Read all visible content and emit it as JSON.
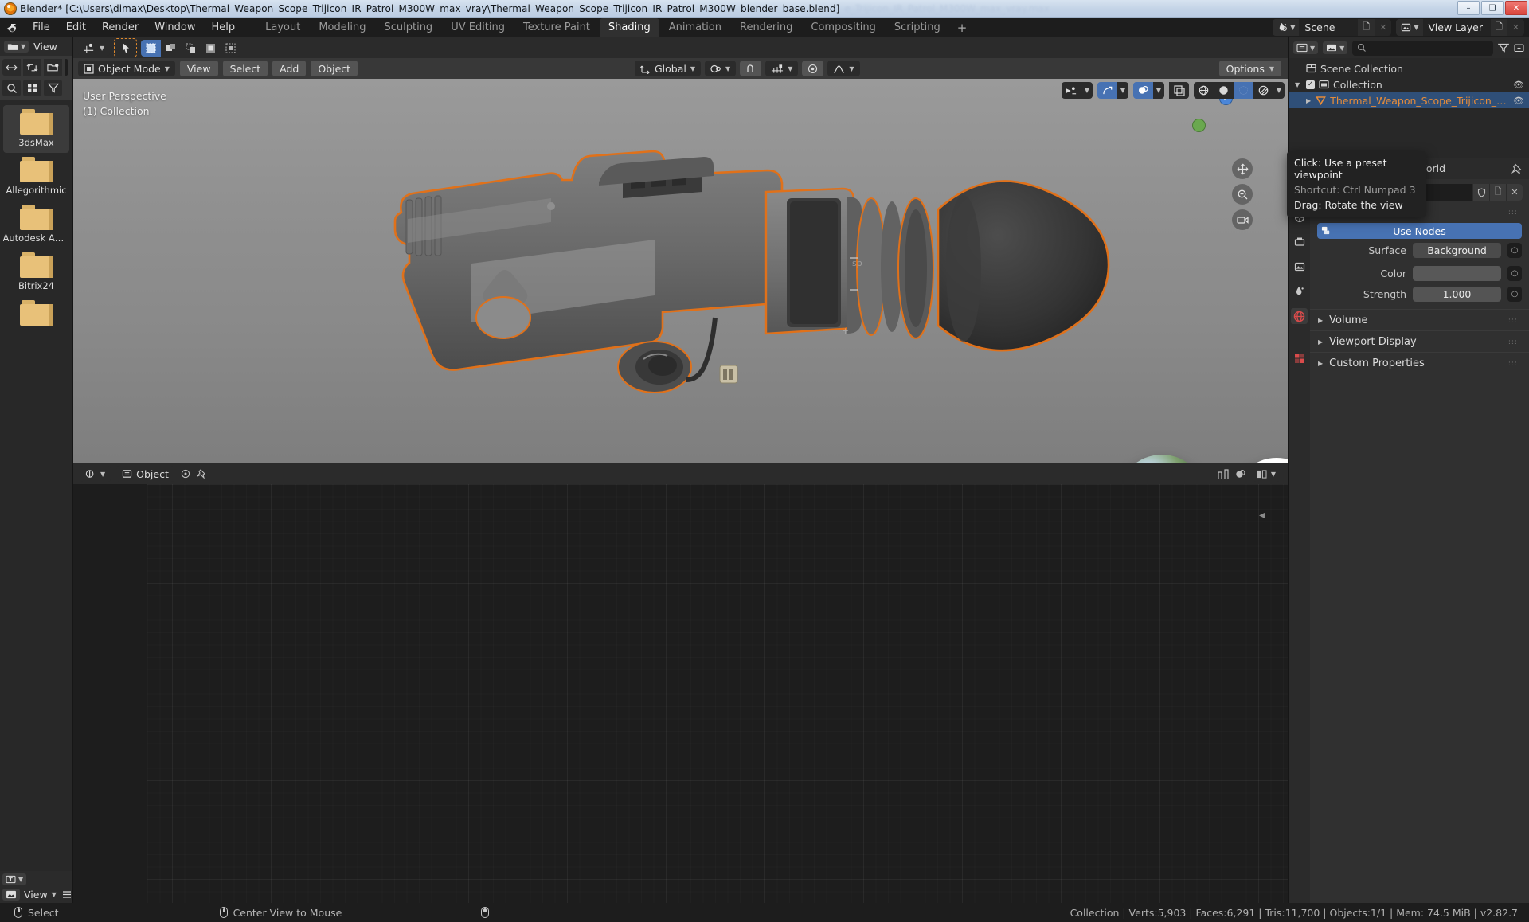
{
  "window": {
    "title": "Blender* [C:\\Users\\dimax\\Desktop\\Thermal_Weapon_Scope_Trijicon_IR_Patrol_M300W_max_vray\\Thermal_Weapon_Scope_Trijicon_IR_Patrol_M300W_blender_base.blend]",
    "ghost_text": "e_Trijicon_IR_Patrol_M300W_max_vray.max",
    "minimize": "–",
    "maximize": "❑",
    "close": "✕"
  },
  "topbar": {
    "menus": [
      "File",
      "Edit",
      "Render",
      "Window",
      "Help"
    ],
    "workspaces": [
      "Layout",
      "Modeling",
      "Sculpting",
      "UV Editing",
      "Texture Paint",
      "Shading",
      "Animation",
      "Rendering",
      "Compositing",
      "Scripting"
    ],
    "active_workspace": "Shading",
    "add_workspace": "+",
    "scene_label": "Scene",
    "view_layer_label": "View Layer"
  },
  "leftbrowser": {
    "view_menu": "View",
    "items": [
      {
        "name": "3dsMax",
        "selected": true
      },
      {
        "name": "Allegorithmic",
        "selected": false
      },
      {
        "name": "Autodesk App..",
        "selected": false
      },
      {
        "name": "Bitrix24",
        "selected": false
      },
      {
        "name": "",
        "selected": false
      }
    ],
    "footer_view": "View"
  },
  "viewport": {
    "mode": "Object Mode",
    "menus": [
      "View",
      "Select",
      "Add",
      "Object"
    ],
    "transform_orientation": "Global",
    "options_label": "Options",
    "perspective_label": "User Perspective",
    "collection_label": "(1) Collection",
    "tooltip": {
      "line1": "Click: Use a preset viewpoint",
      "line2": "Shortcut: Ctrl Numpad 3",
      "line3": "Drag: Rotate the view"
    }
  },
  "shader_editor": {
    "type_label": "Object"
  },
  "outliner": {
    "search_placeholder": "",
    "rows": [
      {
        "label": "Scene Collection",
        "indent": 0,
        "kind": "scene",
        "selected": false,
        "eye": false,
        "check": false,
        "tri": false
      },
      {
        "label": "Collection",
        "indent": 1,
        "kind": "collection",
        "selected": false,
        "eye": true,
        "check": true,
        "tri": true
      },
      {
        "label": "Thermal_Weapon_Scope_Trijicon_IR_Patrol_M",
        "indent": 2,
        "kind": "object",
        "selected": true,
        "eye": true,
        "check": false,
        "tri": true
      }
    ]
  },
  "properties": {
    "breadcrumb_scene": "Scene",
    "breadcrumb_world": "World",
    "datablock_name": "World",
    "surface_panel": "Surface",
    "use_nodes": "Use Nodes",
    "fields": [
      {
        "label": "Surface",
        "value": "Background"
      },
      {
        "label": "Color",
        "value": ""
      },
      {
        "label": "Strength",
        "value": "1.000"
      }
    ],
    "subpanels": [
      "Volume",
      "Viewport Display",
      "Custom Properties"
    ]
  },
  "statusbar": {
    "left_action": "Select",
    "mid_action": "Center View to Mouse",
    "stats": "Collection | Verts:5,903 | Faces:6,291 | Tris:11,700 | Objects:1/1 | Mem: 74.5 MiB | v2.82.7"
  },
  "colors": {
    "accent_blue": "#4772b3",
    "select_orange": "#e68c3a",
    "outliner_sel": "#2f4f78"
  }
}
